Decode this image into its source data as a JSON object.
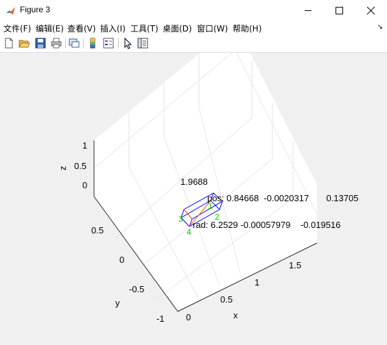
{
  "window": {
    "title": "Figure 3"
  },
  "menu": [
    {
      "label": "文件(F)"
    },
    {
      "label": "编辑(E)"
    },
    {
      "label": "查看(V)"
    },
    {
      "label": "插入(I)"
    },
    {
      "label": "工具(T)"
    },
    {
      "label": "桌面(D)"
    },
    {
      "label": "窗口(W)"
    },
    {
      "label": "帮助(H)"
    }
  ],
  "toolbar": [
    "new-figure-icon",
    "open-file-icon",
    "save-icon",
    "print-icon",
    "link-figure-icon",
    "colorbar-icon",
    "legend-icon",
    "edit-plot-icon",
    "property-editor-icon"
  ],
  "axes": {
    "z_label": "z",
    "y_label": "y",
    "x_label": "x",
    "z_ticks": [
      "1",
      "0.5",
      "0"
    ],
    "y_ticks": [
      "0.5",
      "0",
      "-0.5",
      "-1"
    ],
    "x_ticks": [
      "0",
      "0.5",
      "1",
      "1.5"
    ]
  },
  "annotations": {
    "value_text": "1.9688",
    "pos_text": "pos: 0.84668  -0.0020317       0.13705",
    "rad_text": "rad: 6.2529 -0.00057979    -0.019516",
    "corner_labels": [
      "1",
      "2",
      "3",
      "4"
    ]
  },
  "colors": {
    "box": "#0000ff",
    "corners": "#00cc00",
    "diag": "#ff6600"
  }
}
